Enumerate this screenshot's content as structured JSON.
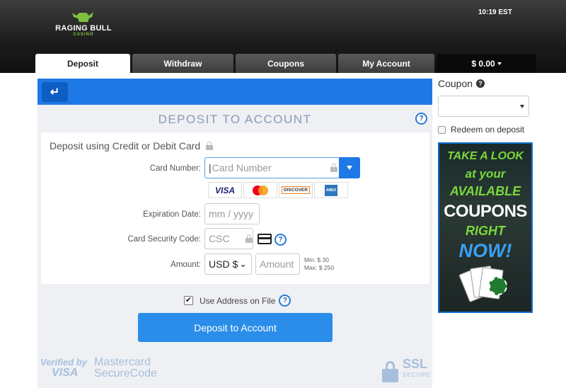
{
  "brand": {
    "name": "RAGING BULL",
    "sub": "CASINO"
  },
  "clock": "10:19 EST",
  "tabs": [
    {
      "label": "Deposit",
      "active": true
    },
    {
      "label": "Withdraw",
      "active": false
    },
    {
      "label": "Coupons",
      "active": false
    },
    {
      "label": "My Account",
      "active": false
    }
  ],
  "balance": "$ 0.00",
  "panel": {
    "title": "DEPOSIT TO ACCOUNT",
    "help": "?",
    "heading": "Deposit using Credit or Debit Card",
    "card_number": {
      "label": "Card Number:",
      "placeholder": "Card Number"
    },
    "card_logos": [
      "VISA",
      "mastercard",
      "DISCOVER",
      "AMERICAN EXPRESS"
    ],
    "expiration": {
      "label": "Expiration Date:",
      "placeholder": "mm / yyyy"
    },
    "csc": {
      "label": "Card Security Code:",
      "placeholder": "CSC"
    },
    "amount": {
      "label": "Amount:",
      "currency": "USD $",
      "placeholder": "Amount",
      "min": "Min: $ 30",
      "max": "Max: $ 250"
    },
    "use_address": {
      "label": "Use Address on File",
      "checked": true
    },
    "submit": "Deposit to Account"
  },
  "footer": {
    "verified_line1": "Verified by",
    "verified_line2": "VISA",
    "securecode_line1": "Mastercard",
    "securecode_line2": "SecureCode",
    "ssl": "SSL",
    "ssl_sub": "SECURE"
  },
  "sidebar": {
    "coupon_label": "Coupon",
    "redeem_label": "Redeem on deposit",
    "redeem_checked": false,
    "promo": [
      "TAKE A LOOK",
      "at your",
      "AVAILABLE",
      "COUPONS",
      "RIGHT",
      "NOW!"
    ]
  },
  "colors": {
    "accent": "#1e79e6",
    "promo_green": "#7ad83a",
    "header": "#1b1b1b"
  }
}
